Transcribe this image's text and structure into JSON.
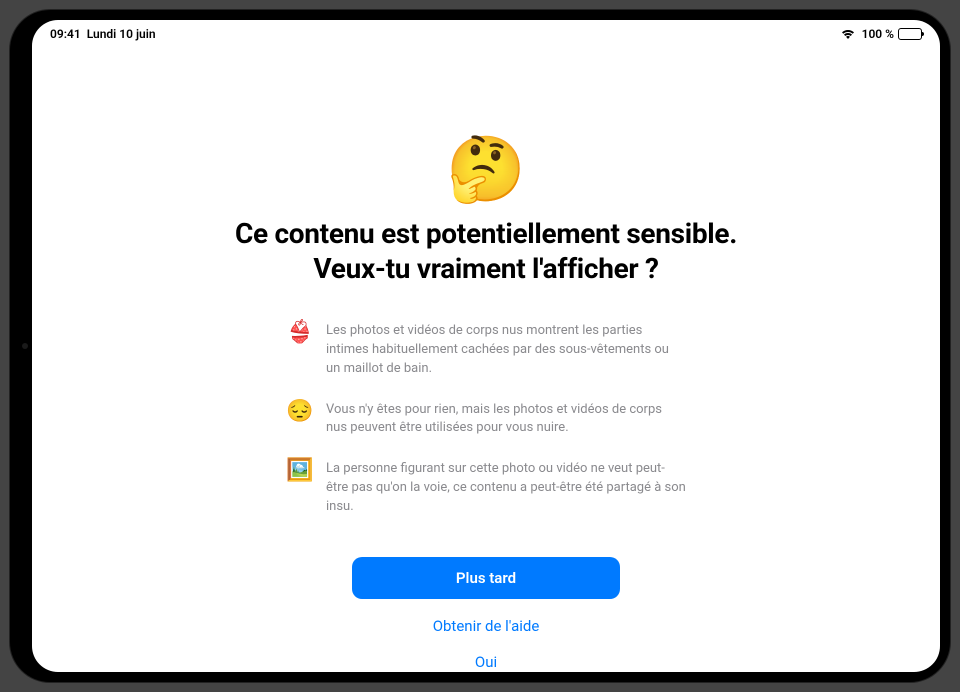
{
  "status": {
    "time": "09:41",
    "date": "Lundi 10 juin",
    "battery_label": "100 %"
  },
  "hero": {
    "emoji": "🤔",
    "title": "Ce contenu est potentiellement sensible.\nVeux-tu vraiment l'afficher ?"
  },
  "bullets": [
    {
      "icon": "👙",
      "icon_name": "swimsuit-icon",
      "text": "Les photos et vidéos de corps nus montrent les parties intimes habituellement cachées par des sous-vêtements ou un maillot de bain."
    },
    {
      "icon": "😔",
      "icon_name": "pensive-face-icon",
      "text": "Vous n'y êtes pour rien, mais les photos et vidéos de corps nus peuvent être utilisées pour vous nuire."
    },
    {
      "icon": "🖼️",
      "icon_name": "framed-picture-icon",
      "text": "La personne figurant sur cette photo ou vidéo ne veut peut-être pas qu'on la voie, ce contenu a peut-être été partagé à son insu."
    }
  ],
  "buttons": {
    "primary": "Plus tard",
    "help": "Obtenir de l'aide",
    "confirm": "Oui"
  }
}
